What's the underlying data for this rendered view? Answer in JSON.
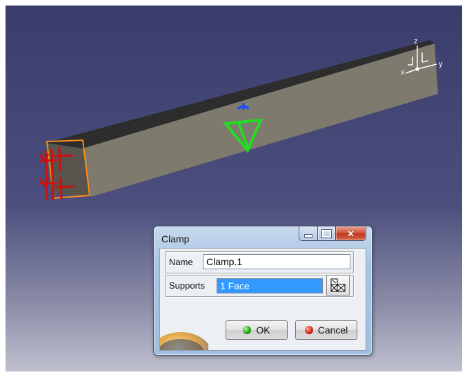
{
  "viewport": {
    "axis_labels": {
      "z": "z",
      "x": "x",
      "y": "y"
    }
  },
  "icons": {
    "beam": "beam-3d",
    "clamp_symbols": "clamp-restraint-symbols",
    "selected_face": "selected-face-highlight",
    "load_symbol": "green-load-symbol",
    "compass": "xyz-axis-compass"
  },
  "dialog": {
    "title": "Clamp",
    "name_label": "Name",
    "name_value": "Clamp.1",
    "supports_label": "Supports",
    "supports_value": "1 Face",
    "ok_label": "OK",
    "cancel_label": "Cancel"
  },
  "colors": {
    "selection": "#3399ff",
    "clamp": "#cc1010",
    "face_highlight": "#ff8c1a",
    "load_symbol": "#22dd22"
  }
}
